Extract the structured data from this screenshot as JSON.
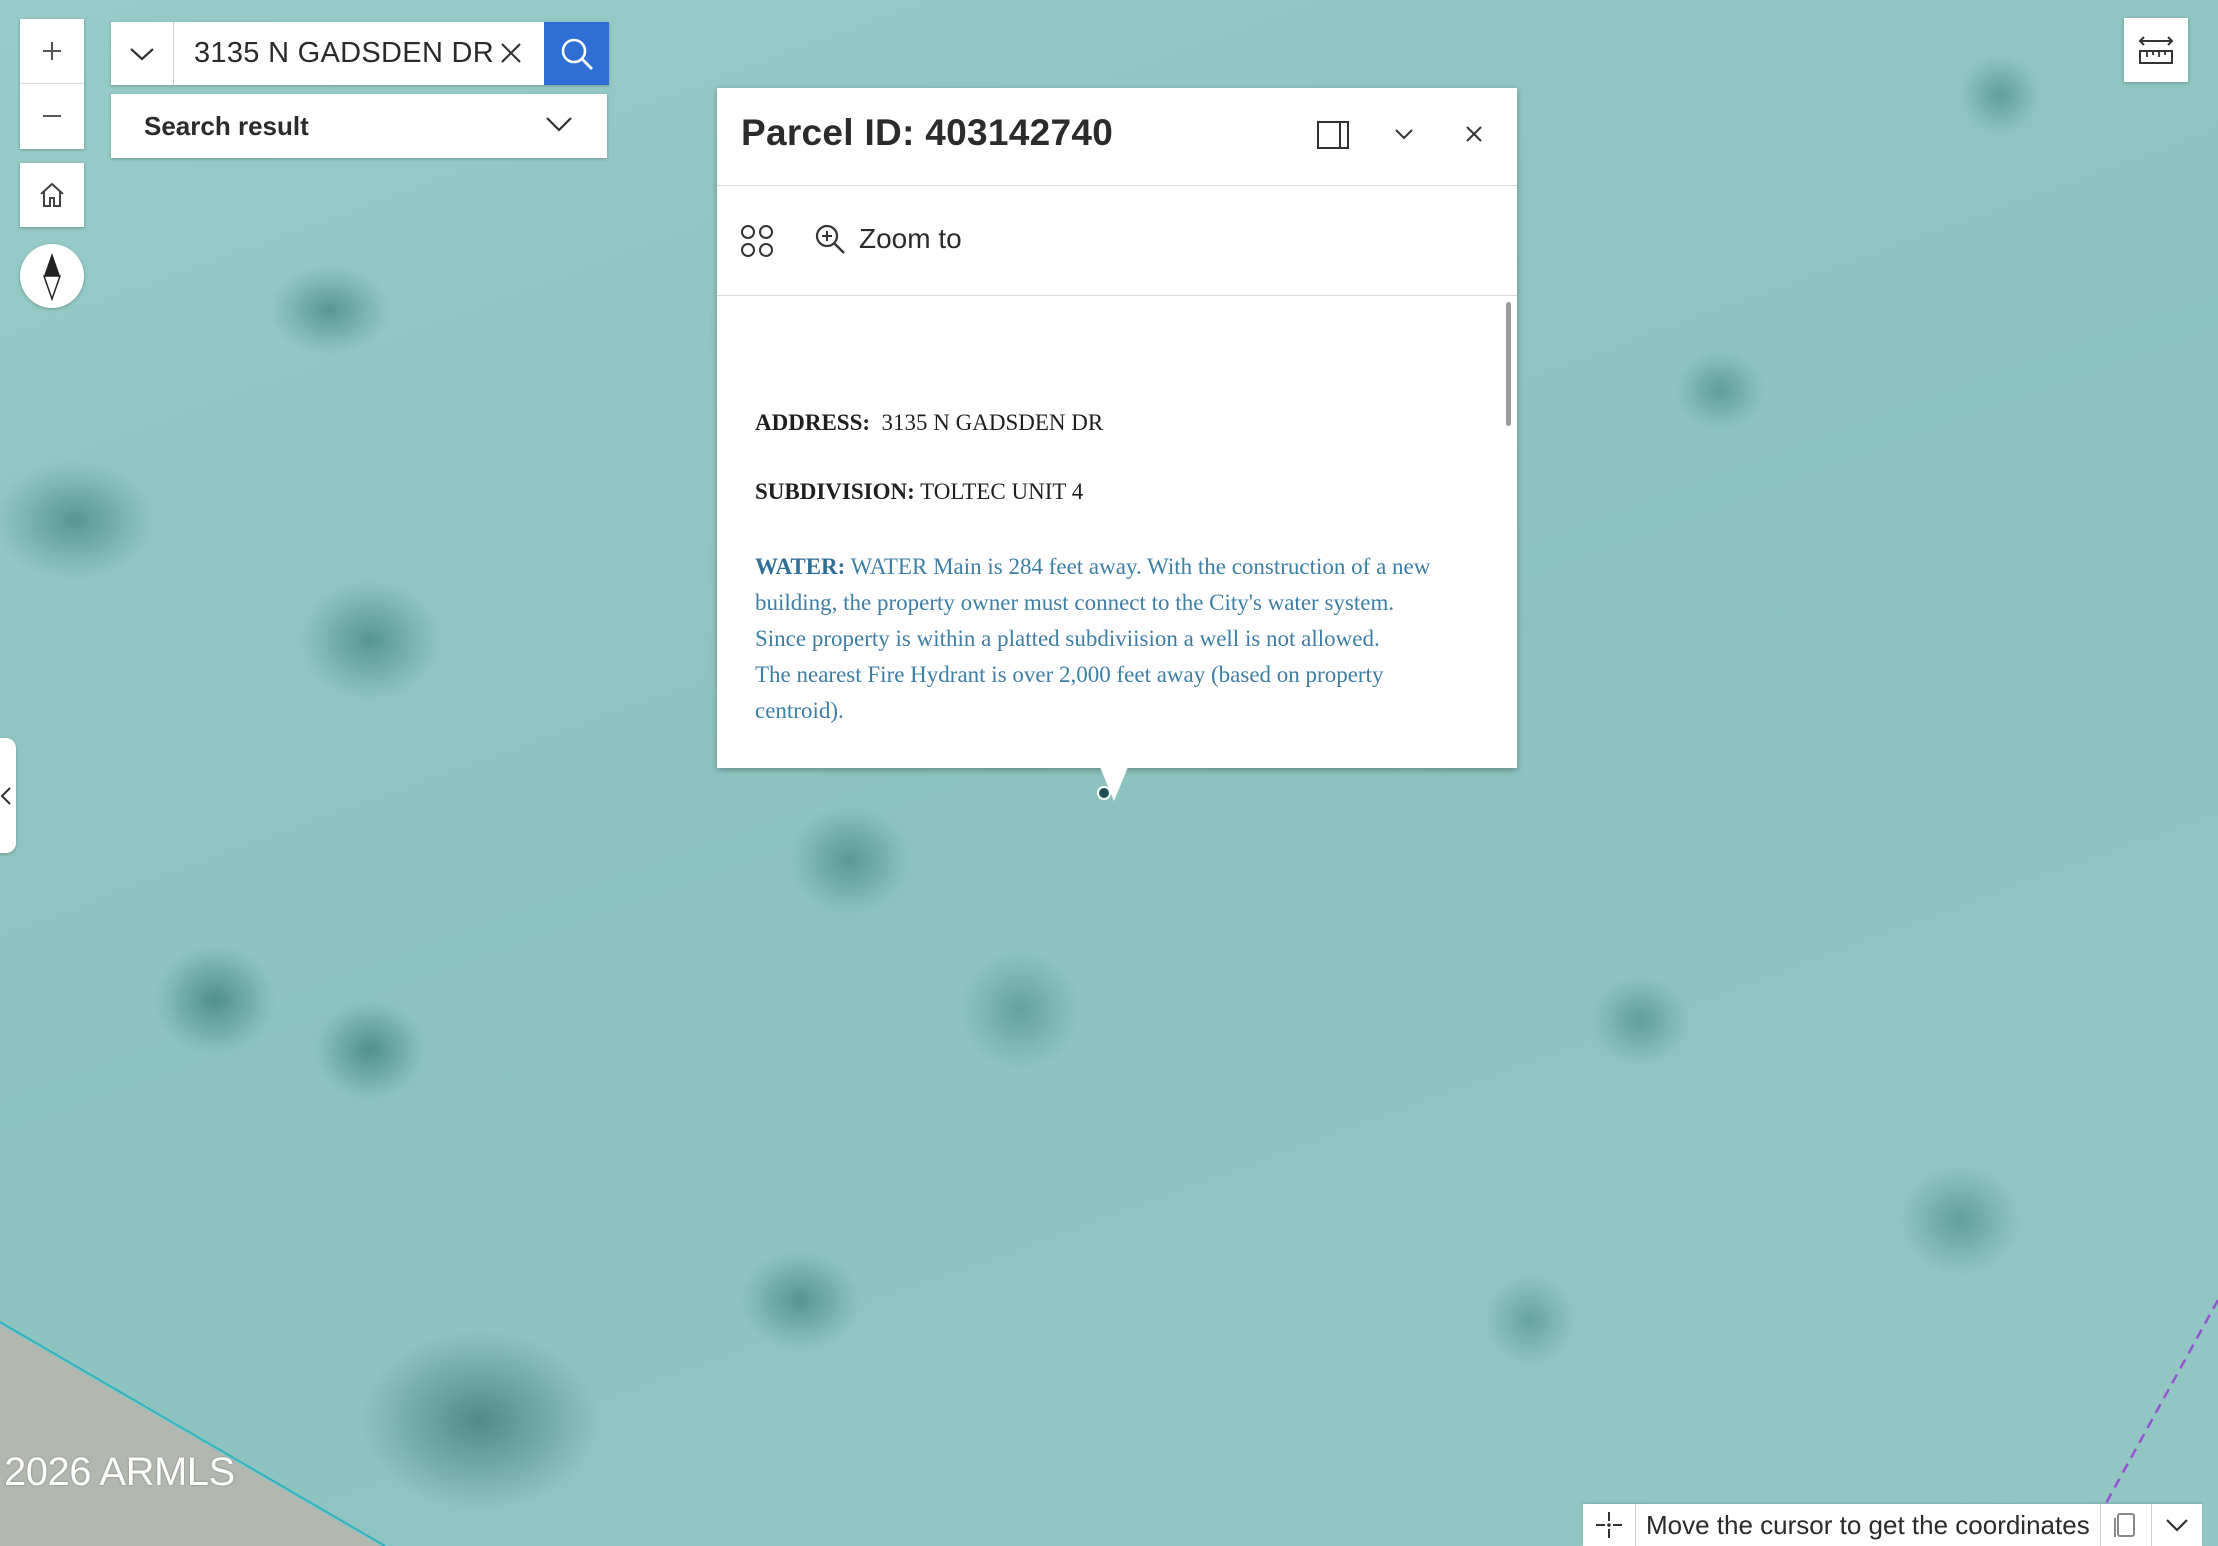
{
  "search": {
    "value": "3135 N GADSDEN DR",
    "result_label": "Search result"
  },
  "popup": {
    "title": "Parcel ID: 403142740",
    "zoom_label": "Zoom to",
    "fields": {
      "address_label": "ADDRESS:",
      "address_value": "3135 N GADSDEN DR",
      "subdivision_label": "SUBDIVISION:",
      "subdivision_value": "TOLTEC UNIT 4",
      "water_label": "WATER:",
      "water_line1": "WATER Main is 284 feet away. With the construction of a new building, the property owner must connect to the City's water system.",
      "water_line2": "Since property is within a platted subdiviision a well is not allowed.",
      "water_line3": "The nearest Fire Hydrant is over 2,000 feet away (based on property centroid)."
    }
  },
  "map": {
    "attribution": "2026 ARMLS",
    "coordinates_text": "Move the cursor to get the coordinates"
  },
  "colors": {
    "search_button": "#2e6fd6",
    "water_text": "#3d7fa4",
    "map_base": "#8dc4c0",
    "parcel_line": "#2fb3c3",
    "dashed_boundary": "#9b4fd6"
  },
  "icons": [
    "plus-icon",
    "minus-icon",
    "home-icon",
    "compass-icon",
    "chevron-down-icon",
    "close-icon",
    "search-icon",
    "ruler-expand-icon",
    "dock-icon",
    "apps-icon",
    "zoom-in-icon",
    "crosshair-icon",
    "copy-icon",
    "chevron-left-icon"
  ]
}
